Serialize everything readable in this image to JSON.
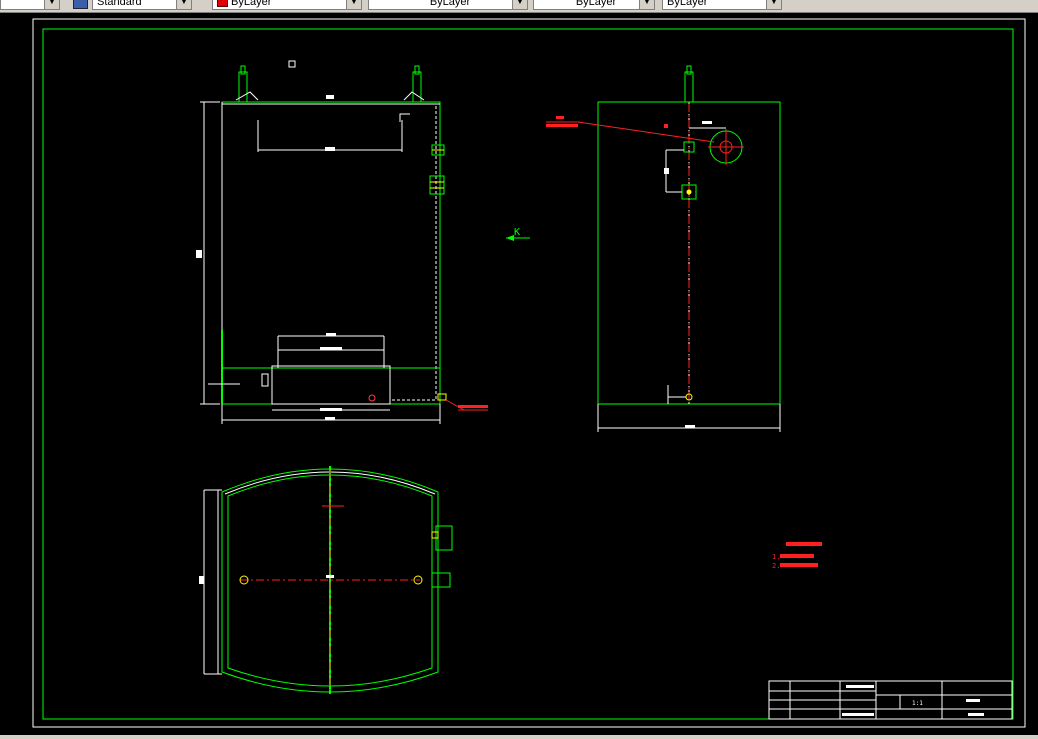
{
  "toolbar": {
    "textstyle_label": "Standard",
    "color_label": "ByLayer",
    "linetype_label": "ByLayer",
    "lineweight_label": "ByLayer",
    "plotstyle_label": "ByLayer"
  },
  "drawing": {
    "view_marker": "K",
    "notes_lines": [
      "1. ",
      "2. "
    ],
    "title_block": {
      "drawing_number": "",
      "scale": "1:1",
      "sheet": "A3"
    }
  },
  "colors": {
    "background": "#000000",
    "geometry": "#00ff00",
    "dimensions": "#ffffff",
    "centerline": "#ff0000",
    "annotation": "#ff2020",
    "ui_chrome": "#d4d0c8"
  }
}
